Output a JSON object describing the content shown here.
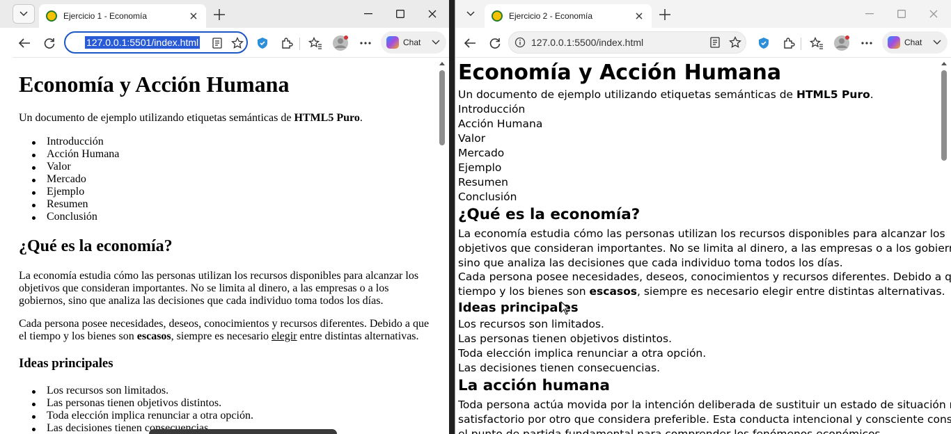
{
  "window1": {
    "tab_title": "Ejercicio 1 - Economía",
    "url": "127.0.0.1:5501/index.html",
    "chat_label": "Chat",
    "page": {
      "title": "Economía y Acción Humana",
      "intro_prefix": "Un documento de ejemplo utilizando etiquetas semánticas de ",
      "intro_strong": "HTML5 Puro",
      "intro_suffix": ".",
      "nav": [
        "Introducción",
        "Acción Humana",
        "Valor",
        "Mercado",
        "Ejemplo",
        "Resumen",
        "Conclusión"
      ],
      "h2": "¿Qué es la economía?",
      "p1_lines": [
        "La economía estudia cómo las personas utilizan los recursos disponibles para alcanzar los",
        "objetivos que consideran importantes. No se limita al dinero, a las empresas o a los",
        "gobiernos, sino que analiza las decisiones que cada individuo toma todos los días."
      ],
      "p2_line1": "Cada persona posee necesidades, deseos, conocimientos y recursos diferentes. Debido a que",
      "p2_l2_a": "el tiempo y los bienes son ",
      "p2_l2_strong": "escasos",
      "p2_l2_b": ", siempre es necesario ",
      "p2_l2_link": "elegir",
      "p2_l2_c": " entre distintas alternativas.",
      "h3": "Ideas principales",
      "ideas": [
        "Los recursos son limitados.",
        "Las personas tienen objetivos distintos.",
        "Toda elección implica renunciar a otra opción.",
        "Las decisiones tienen consecuencias."
      ]
    }
  },
  "window2": {
    "tab_title": "Ejercicio 2 - Economía",
    "url": "127.0.0.1:5500/index.html",
    "chat_label": "Chat",
    "page": {
      "title": "Economía y Acción Humana",
      "intro_prefix": "Un documento de ejemplo utilizando etiquetas semánticas de ",
      "intro_strong": "HTML5 Puro",
      "intro_suffix": ".",
      "nav": [
        "Introducción",
        "Acción Humana",
        "Valor",
        "Mercado",
        "Ejemplo",
        "Resumen",
        "Conclusión"
      ],
      "h2": "¿Qué es la economía?",
      "p1_lines": [
        "La economía estudia cómo las personas utilizan los recursos disponibles para alcanzar los",
        "objetivos que consideran importantes. No se limita al dinero, a las empresas o a los gobiernos,",
        "sino que analiza las decisiones que cada individuo toma todos los días."
      ],
      "p2_line1": "Cada persona posee necesidades, deseos, conocimientos y recursos diferentes. Debido a que el",
      "p2_l2_a": "tiempo y los bienes son ",
      "p2_l2_strong": "escasos",
      "p2_l2_b": ", siempre es necesario elegir entre distintas alternativas.",
      "h3": "Ideas principales",
      "ideas": [
        "Los recursos son limitados.",
        "Las personas tienen objetivos distintos.",
        "Toda elección implica renunciar a otra opción.",
        "Las decisiones tienen consecuencias."
      ],
      "h2b": "La acción humana",
      "p3_lines": [
        "Toda persona actúa movida por la intención deliberada de sustituir un estado de situación menos",
        "satisfactorio por otro que considera preferible. Esta conducta intencional y consciente constituye",
        "el punto de partida fundamental para comprender los fenómenos económicos."
      ]
    }
  }
}
